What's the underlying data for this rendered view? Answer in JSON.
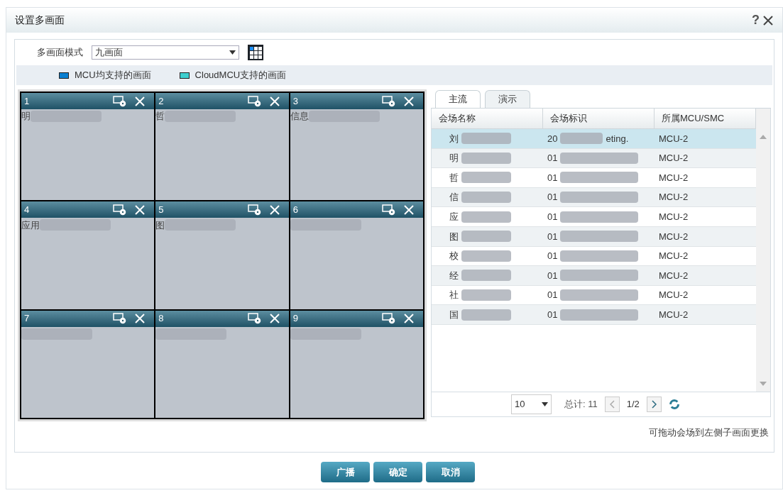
{
  "dialog": {
    "title": "设置多画面",
    "help": "?"
  },
  "mode": {
    "label": "多画面模式",
    "value": "九画面"
  },
  "legend": [
    {
      "label": "MCU均支持的画面",
      "color": "#0a7fd0"
    },
    {
      "label": "CloudMCU支持的画面",
      "color": "#3ecfcf"
    }
  ],
  "tiles": [
    {
      "number": "1",
      "site": "明"
    },
    {
      "number": "2",
      "site": "哲"
    },
    {
      "number": "3",
      "site": "信息"
    },
    {
      "number": "4",
      "site": "应用"
    },
    {
      "number": "5",
      "site": "图"
    },
    {
      "number": "6"
    },
    {
      "number": "7"
    },
    {
      "number": "8"
    },
    {
      "number": "9"
    }
  ],
  "tabs": [
    {
      "label": "主流",
      "selected": true
    },
    {
      "label": "演示",
      "selected": false
    }
  ],
  "table": {
    "columns": [
      "会场名称",
      "会场标识",
      "所属MCU/SMC"
    ],
    "rows": [
      {
        "name": "刘",
        "id": "20",
        "id_tail": "eting.",
        "mcu": "MCU-2",
        "selected": true
      },
      {
        "name": "明",
        "id": "01",
        "mcu": "MCU-2",
        "selected": false
      },
      {
        "name": "哲",
        "id": "01",
        "mcu": "MCU-2",
        "selected": false
      },
      {
        "name": "信",
        "id": "01",
        "mcu": "MCU-2",
        "selected": false
      },
      {
        "name": "应",
        "id": "01",
        "mcu": "MCU-2",
        "selected": false
      },
      {
        "name": "图",
        "id": "01",
        "mcu": "MCU-2",
        "selected": false
      },
      {
        "name": "校",
        "id": "01",
        "mcu": "MCU-2",
        "selected": false
      },
      {
        "name": "经",
        "id": "01",
        "mcu": "MCU-2",
        "selected": false
      },
      {
        "name": "社",
        "id": "01",
        "mcu": "MCU-2",
        "selected": false
      },
      {
        "name": "国",
        "id": "01",
        "mcu": "MCU-2",
        "selected": false
      }
    ]
  },
  "pagination": {
    "page_size": "10",
    "total": "总计: 11",
    "page": "1/2"
  },
  "hint": "可拖动会场到左侧子画面更换",
  "buttons": [
    "广播",
    "确定",
    "取消"
  ]
}
